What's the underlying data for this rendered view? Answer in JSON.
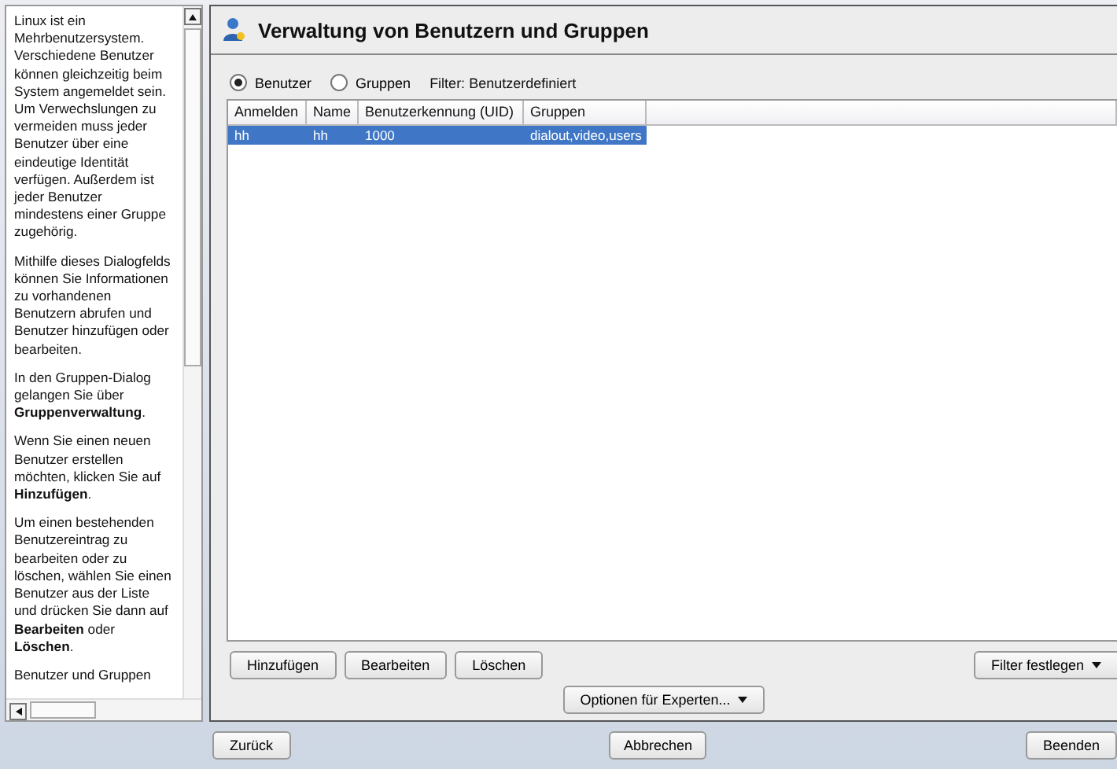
{
  "help": {
    "paragraphs": [
      "Linux ist ein Mehrbenutzersystem. Verschiedene Benutzer können gleichzeitig beim System angemeldet sein. Um Verwechslungen zu vermeiden muss jeder Benutzer über eine eindeutige Identität verfügen. Außerdem ist jeder Benutzer mindestens einer Gruppe zugehörig.",
      "Mithilfe dieses Dialogfelds können Sie Informationen zu vorhandenen Benutzern abrufen und Benutzer hinzufügen oder bearbeiten.",
      "In den Gruppen-Dialog gelangen Sie über **Gruppenverwaltung**.",
      "Wenn Sie einen neuen Benutzer erstellen möchten, klicken Sie auf **Hinzufügen**.",
      "Um einen bestehenden Benutzereintrag zu bearbeiten oder zu löschen, wählen Sie einen Benutzer aus der Liste und drücken Sie dann auf **Bearbeiten** oder **Löschen**.",
      "Benutzer und Gruppen"
    ]
  },
  "title": "Verwaltung von Benutzern und Gruppen",
  "view": [
    {
      "label": "Benutzer",
      "selected": true
    },
    {
      "label": "Gruppen",
      "selected": false
    }
  ],
  "filter": "Filter: Benutzerdefiniert",
  "table": {
    "columns": [
      "Anmelden",
      "Name",
      "Benutzerkennung (UID)",
      "Gruppen"
    ],
    "rows": [
      {
        "cells": [
          "hh",
          "hh",
          "1000",
          "dialout,video,users"
        ],
        "selected": true
      }
    ]
  },
  "actions": [
    "Hinzufügen",
    "Bearbeiten",
    "Löschen"
  ],
  "filter_button": "Filter festlegen",
  "expert_button": "Optionen für Experten...",
  "footer": [
    "Zurück",
    "Abbrechen",
    "Beenden"
  ]
}
